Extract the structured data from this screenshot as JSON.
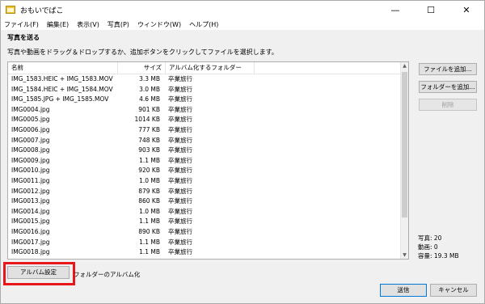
{
  "window": {
    "title": "おもいでばこ",
    "controls": {
      "minimize": "—",
      "maximize": "☐",
      "close": "✕"
    }
  },
  "menu": [
    "ファイル(F)",
    "編集(E)",
    "表示(V)",
    "写真(P)",
    "ウィンドウ(W)",
    "ヘルプ(H)"
  ],
  "section_title": "写真を送る",
  "instruction": "写真や動画をドラッグ＆ドロップするか、追加ボタンをクリックしてファイルを選択します。",
  "list": {
    "headers": {
      "name": "名前",
      "size": "サイズ",
      "folder": "アルバム化するフォルダー"
    },
    "rows": [
      {
        "name": "IMG_1583.HEIC + IMG_1583.MOV",
        "size": "3.3 MB",
        "folder": "卒業旅行"
      },
      {
        "name": "IMG_1584.HEIC + IMG_1584.MOV",
        "size": "3.0 MB",
        "folder": "卒業旅行"
      },
      {
        "name": "IMG_1585.JPG + IMG_1585.MOV",
        "size": "4.6 MB",
        "folder": "卒業旅行"
      },
      {
        "name": "IMG0004.jpg",
        "size": "901 KB",
        "folder": "卒業旅行"
      },
      {
        "name": "IMG0005.jpg",
        "size": "1014 KB",
        "folder": "卒業旅行"
      },
      {
        "name": "IMG0006.jpg",
        "size": "777 KB",
        "folder": "卒業旅行"
      },
      {
        "name": "IMG0007.jpg",
        "size": "748 KB",
        "folder": "卒業旅行"
      },
      {
        "name": "IMG0008.jpg",
        "size": "903 KB",
        "folder": "卒業旅行"
      },
      {
        "name": "IMG0009.jpg",
        "size": "1.1 MB",
        "folder": "卒業旅行"
      },
      {
        "name": "IMG0010.jpg",
        "size": "920 KB",
        "folder": "卒業旅行"
      },
      {
        "name": "IMG0011.jpg",
        "size": "1.0 MB",
        "folder": "卒業旅行"
      },
      {
        "name": "IMG0012.jpg",
        "size": "879 KB",
        "folder": "卒業旅行"
      },
      {
        "name": "IMG0013.jpg",
        "size": "860 KB",
        "folder": "卒業旅行"
      },
      {
        "name": "IMG0014.jpg",
        "size": "1.0 MB",
        "folder": "卒業旅行"
      },
      {
        "name": "IMG0015.jpg",
        "size": "1.1 MB",
        "folder": "卒業旅行"
      },
      {
        "name": "IMG0016.jpg",
        "size": "890 KB",
        "folder": "卒業旅行"
      },
      {
        "name": "IMG0017.jpg",
        "size": "1.1 MB",
        "folder": "卒業旅行"
      },
      {
        "name": "IMG0018.jpg",
        "size": "1.1 MB",
        "folder": "卒業旅行"
      }
    ]
  },
  "side_buttons": {
    "add_file": "ファイルを追加...",
    "add_folder": "フォルダーを追加...",
    "delete": "削除"
  },
  "stats": {
    "photos": "写真: 20",
    "videos": "動画: 0",
    "capacity": "容量: 19.3 MB"
  },
  "footer": {
    "album_settings": "アルバム設定",
    "checkbox_label": "フォルダーのアルバム化",
    "send": "送信",
    "cancel": "キャンセル"
  },
  "colors": {
    "highlight": "#e8161a",
    "send_border": "#0078d7"
  }
}
